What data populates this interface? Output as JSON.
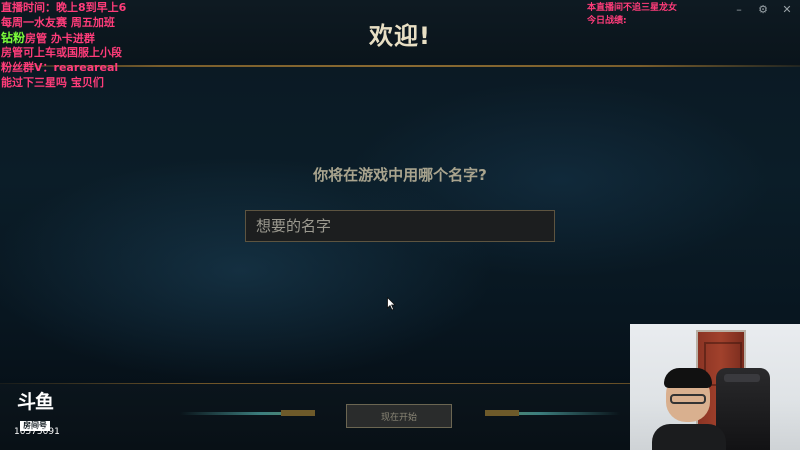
{
  "window": {
    "title": "欢迎!",
    "controls": {
      "minimize": "–",
      "settings": "⚙",
      "close": "✕"
    }
  },
  "form": {
    "question": "你将在游戏中用哪个名字?",
    "name_placeholder": "想要的名字",
    "start_button": "现在开始"
  },
  "overlay_left": {
    "lines": [
      "直播时间：晚上8到早上6",
      "每周一水友赛 周五加班",
      "房管 办卡进群",
      "房管可上车或国服上小段",
      "粉丝群V：reareareal",
      "能过下三星吗 宝贝们"
    ],
    "badge": "钻粉"
  },
  "overlay_right": {
    "lines": [
      "本直播间不追三星龙女",
      "今日战绩:"
    ]
  },
  "stream": {
    "logo_text": "斗鱼",
    "room_label": "房间号",
    "room_number": "10575091"
  },
  "colors": {
    "accent_gold": "#7a5e2c",
    "title_text": "#e8dfc4",
    "overlay_pink": "#ff3c7a",
    "overlay_green": "#7dff3a"
  }
}
